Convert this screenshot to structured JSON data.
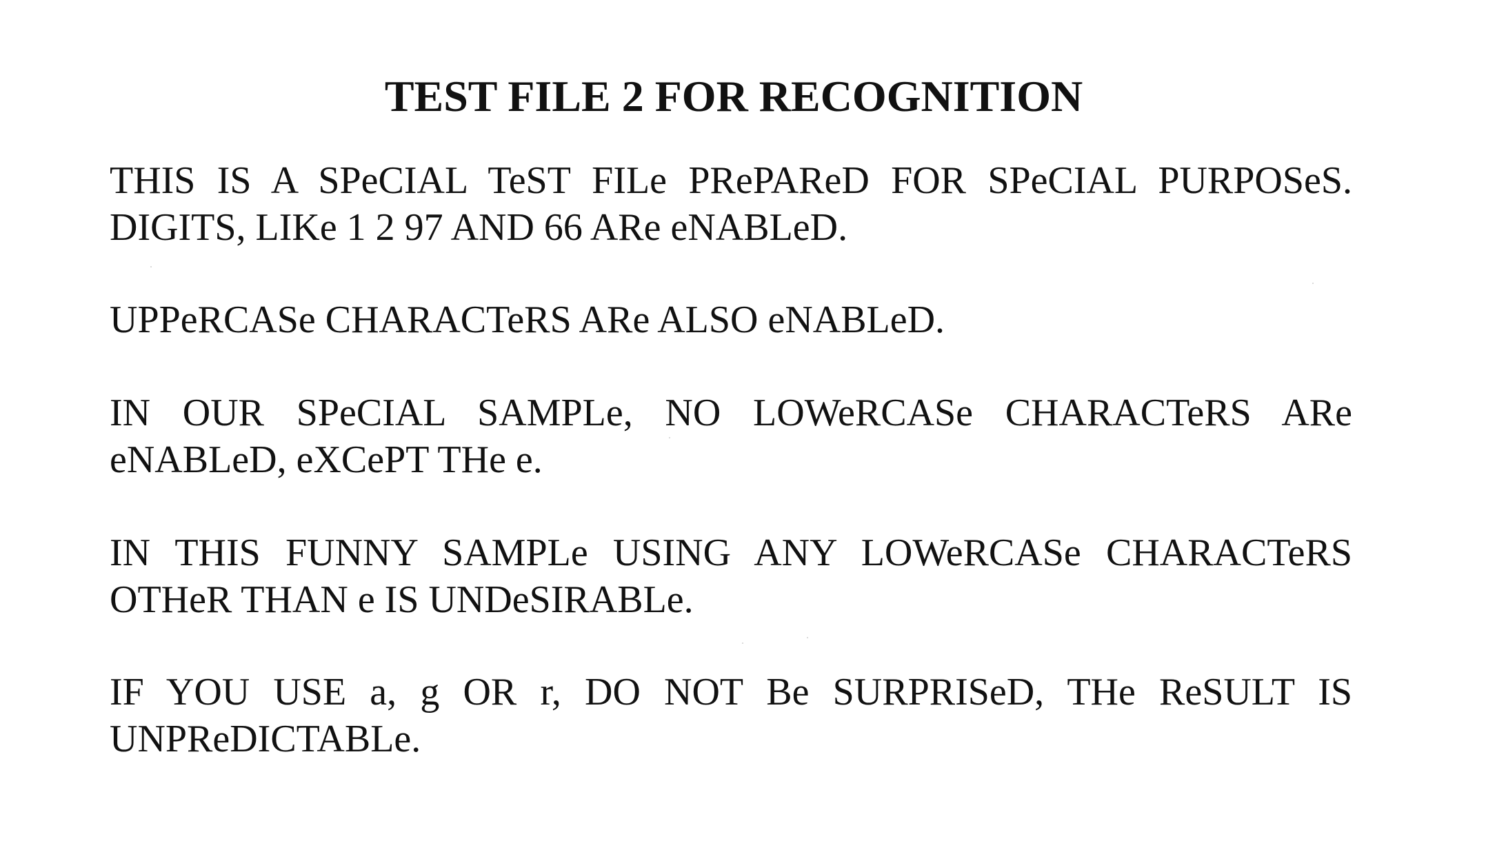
{
  "document": {
    "title": "TEST FILE 2 FOR RECOGNITION",
    "paragraphs": [
      {
        "lines": [
          "THIS IS A SPeCIAL TeST FILe PRePAReD FOR SPeCIAL PURPOSeS.",
          "DIGITS, LIKe 1 2 97 AND 66 ARe eNABLeD."
        ]
      },
      {
        "lines": [
          "UPPeRCASe CHARACTeRS ARe ALSO eNABLeD."
        ]
      },
      {
        "lines": [
          "IN OUR SPeCIAL SAMPLe, NO LOWeRCASe CHARACTeRS ARe",
          "eNABLeD, eXCePT THe e."
        ]
      },
      {
        "lines": [
          "IN THIS FUNNY SAMPLe USING ANY LOWeRCASe CHARACTeRS",
          "OTHeR THAN e IS UNDeSIRABLe."
        ]
      },
      {
        "lines": [
          "IF YOU USE a, g OR r, DO NOT Be SURPRISeD, THe ReSULT IS",
          "UNPReDICTABLe."
        ]
      }
    ]
  }
}
